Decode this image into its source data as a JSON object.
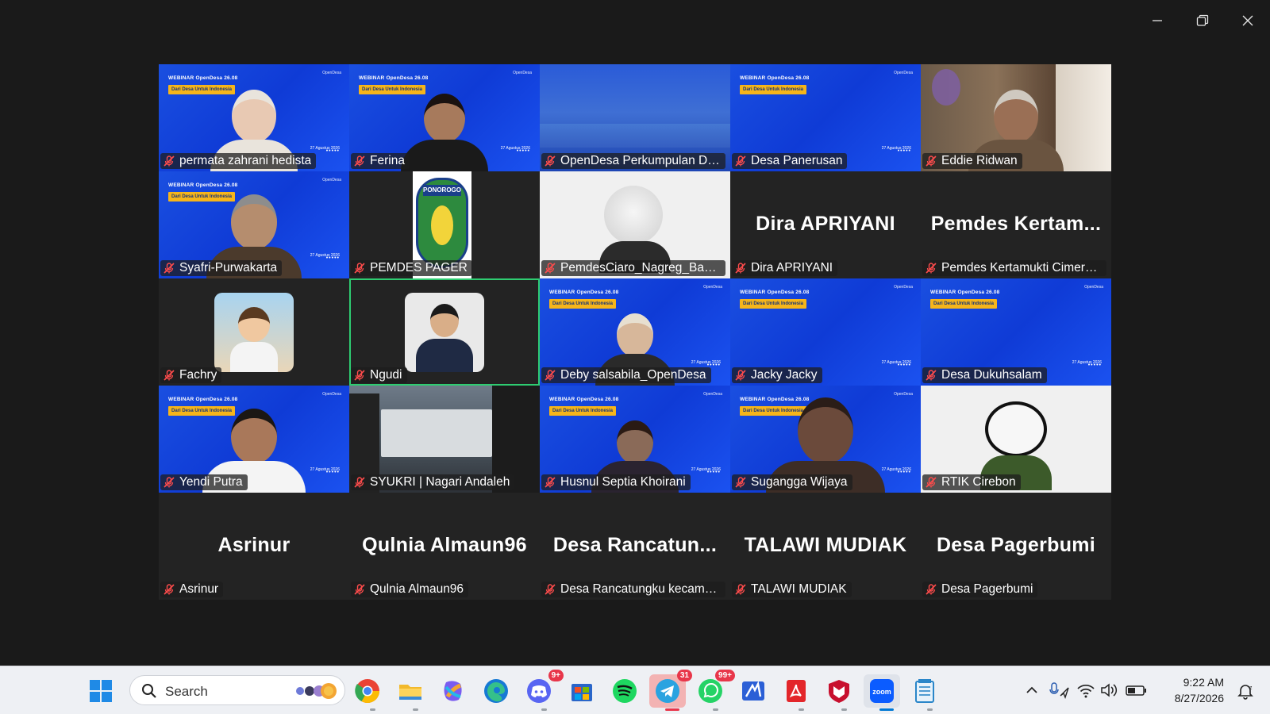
{
  "window": {
    "minimize_icon": "minimize-icon",
    "restore_icon": "restore-icon",
    "close_icon": "close-icon"
  },
  "webinar": {
    "title": "WEBINAR OpenDesa 26.08",
    "badge": "Dari Desa Untuk Indonesia",
    "date": "27 Agustus 2026",
    "logo": "OpenDesa"
  },
  "participants": [
    {
      "name": "permata zahrani hedista",
      "bg": "blue"
    },
    {
      "name": "Ferina",
      "bg": "blue"
    },
    {
      "name": "OpenDesa Perkumpulan Des...",
      "bg": "scenic"
    },
    {
      "name": "Desa Panerusan",
      "bg": "blue"
    },
    {
      "name": "Eddie Ridwan",
      "bg": "room"
    },
    {
      "name": "Syafri-Purwakarta",
      "bg": "blue"
    },
    {
      "name": "PEMDES PAGER",
      "bg": "dark",
      "logo_text": "PONOROGO"
    },
    {
      "name": "PemdesCiaro_Nagreg_Band...",
      "bg": "gray"
    },
    {
      "name": "Dira APRIYANI",
      "bg": "dark",
      "bigname": "Dira APRIYANI"
    },
    {
      "name": "Pemdes Kertamukti Cimerak...",
      "bg": "dark",
      "bigname": "Pemdes  Kertam..."
    },
    {
      "name": "Fachry",
      "bg": "dark"
    },
    {
      "name": "Ngudi",
      "bg": "dark",
      "active": true
    },
    {
      "name": "Deby salsabila_OpenDesa",
      "bg": "blue"
    },
    {
      "name": "Jacky Jacky",
      "bg": "blue"
    },
    {
      "name": "Desa Dukuhsalam",
      "bg": "blue"
    },
    {
      "name": "Yendi Putra",
      "bg": "blue"
    },
    {
      "name": "SYUKRI | Nagari Andaleh",
      "bg": "photo"
    },
    {
      "name": "Husnul Septia Khoirani",
      "bg": "blue"
    },
    {
      "name": "Sugangga Wijaya",
      "bg": "blue"
    },
    {
      "name": "RTIK Cirebon",
      "bg": "gray"
    },
    {
      "name": "Asrinur",
      "bg": "dark",
      "bigname": "Asrinur"
    },
    {
      "name": "Qulnia Almaun96",
      "bg": "dark",
      "bigname": "Qulnia Almaun96"
    },
    {
      "name": "Desa Rancatungku kecamat...",
      "bg": "dark",
      "bigname": "Desa  Rancatun..."
    },
    {
      "name": "TALAWI MUDIAK",
      "bg": "dark",
      "bigname": "TALAWI MUDIAK"
    },
    {
      "name": "Desa Pagerbumi",
      "bg": "dark",
      "bigname": "Desa Pagerbumi"
    }
  ],
  "taskbar": {
    "search_placeholder": "Search",
    "apps": [
      {
        "name": "chrome-icon"
      },
      {
        "name": "file-explorer-icon"
      },
      {
        "name": "copilot-icon"
      },
      {
        "name": "edge-icon"
      },
      {
        "name": "discord-icon",
        "badge": "9+"
      },
      {
        "name": "microsoft-store-icon"
      },
      {
        "name": "spotify-icon"
      },
      {
        "name": "telegram-icon",
        "badge": "31"
      },
      {
        "name": "whatsapp-icon",
        "badge": "99+"
      },
      {
        "name": "app-icon"
      },
      {
        "name": "acrobat-icon"
      },
      {
        "name": "mcafee-icon"
      },
      {
        "name": "zoom-icon",
        "label": "zoom"
      },
      {
        "name": "notepad-icon"
      }
    ],
    "time": "9:22 AM",
    "date": "8/27/2026",
    "accent": "#0078d4"
  }
}
